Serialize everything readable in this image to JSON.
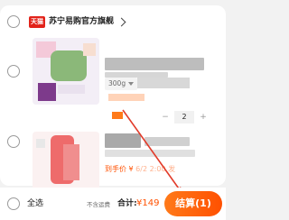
{
  "shop": {
    "badge": "天猫",
    "name": "苏宁易购官方旗舰"
  },
  "item1": {
    "spec": "300g",
    "quantity": "2",
    "minus": "−",
    "plus": "+"
  },
  "item2": {
    "promo": "到手价 ¥ 6/2 2:00 发"
  },
  "footer": {
    "select_all": "全选",
    "no_shipping": "不含运费",
    "total_label": "合计:",
    "total_value": "¥149",
    "checkout": "结算(1)"
  },
  "colors": {
    "accent": "#ff5000",
    "tmall_red": "#e2231a"
  },
  "icons": {
    "shop_chevron": "chevron-right-icon",
    "annotation": "arrow-icon"
  }
}
